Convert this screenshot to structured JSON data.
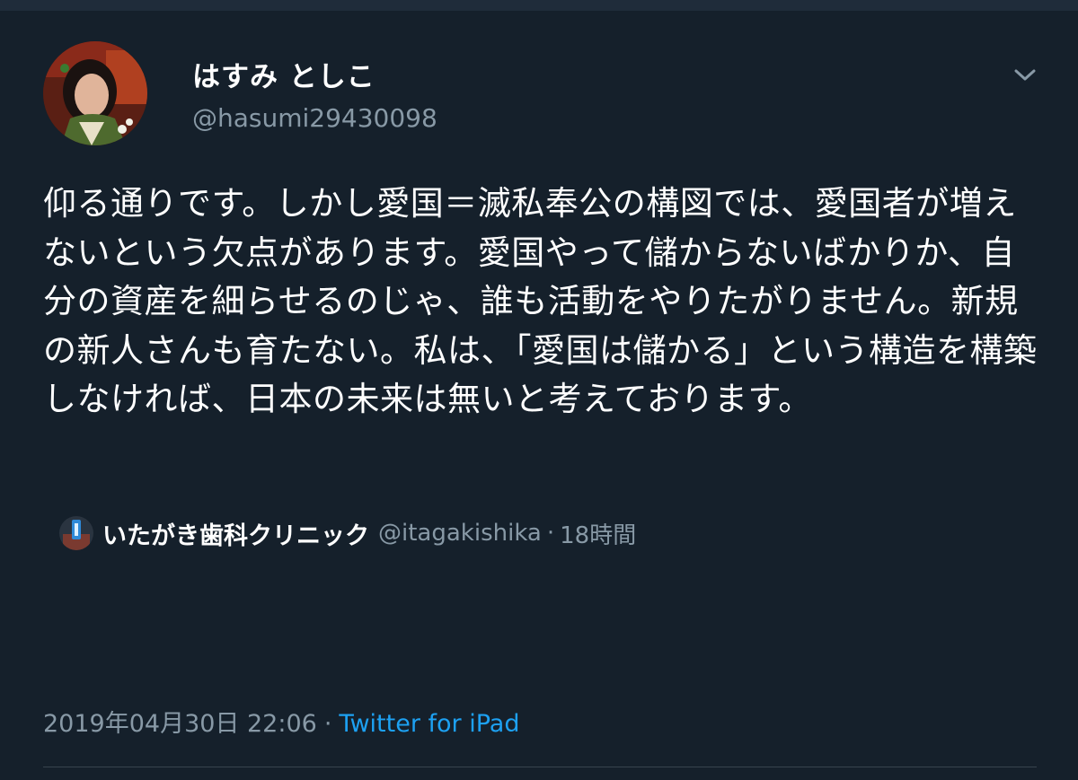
{
  "tweet": {
    "author": {
      "display_name": "はすみ としこ",
      "handle": "@hasumi29430098",
      "avatar_icon": "user-avatar-photo"
    },
    "menu_icon": "chevron-down-icon",
    "text": "仰る通りです。しかし愛国＝滅私奉公の構図では、愛国者が増えないという欠点があります。愛国やって儲からないばかりか、自分の資産を細らせるのじゃ、誰も活動をやりたがりません。新規の新人さんも育たない。私は、「愛国は儲かる」という構造を構築しなければ、日本の未来は無いと考えております。",
    "reply_context": {
      "name": "いたがき歯科クリニック",
      "handle": "@itagakishika",
      "separator": "·",
      "time": "18時間"
    },
    "meta": {
      "datetime": "2019年04月30日 22:06",
      "separator": "·",
      "source": "Twitter for iPad"
    }
  },
  "colors": {
    "background": "#15202b",
    "text_primary": "#ffffff",
    "text_secondary": "#8899a6",
    "link": "#1da1f2",
    "divider": "#38444d"
  }
}
